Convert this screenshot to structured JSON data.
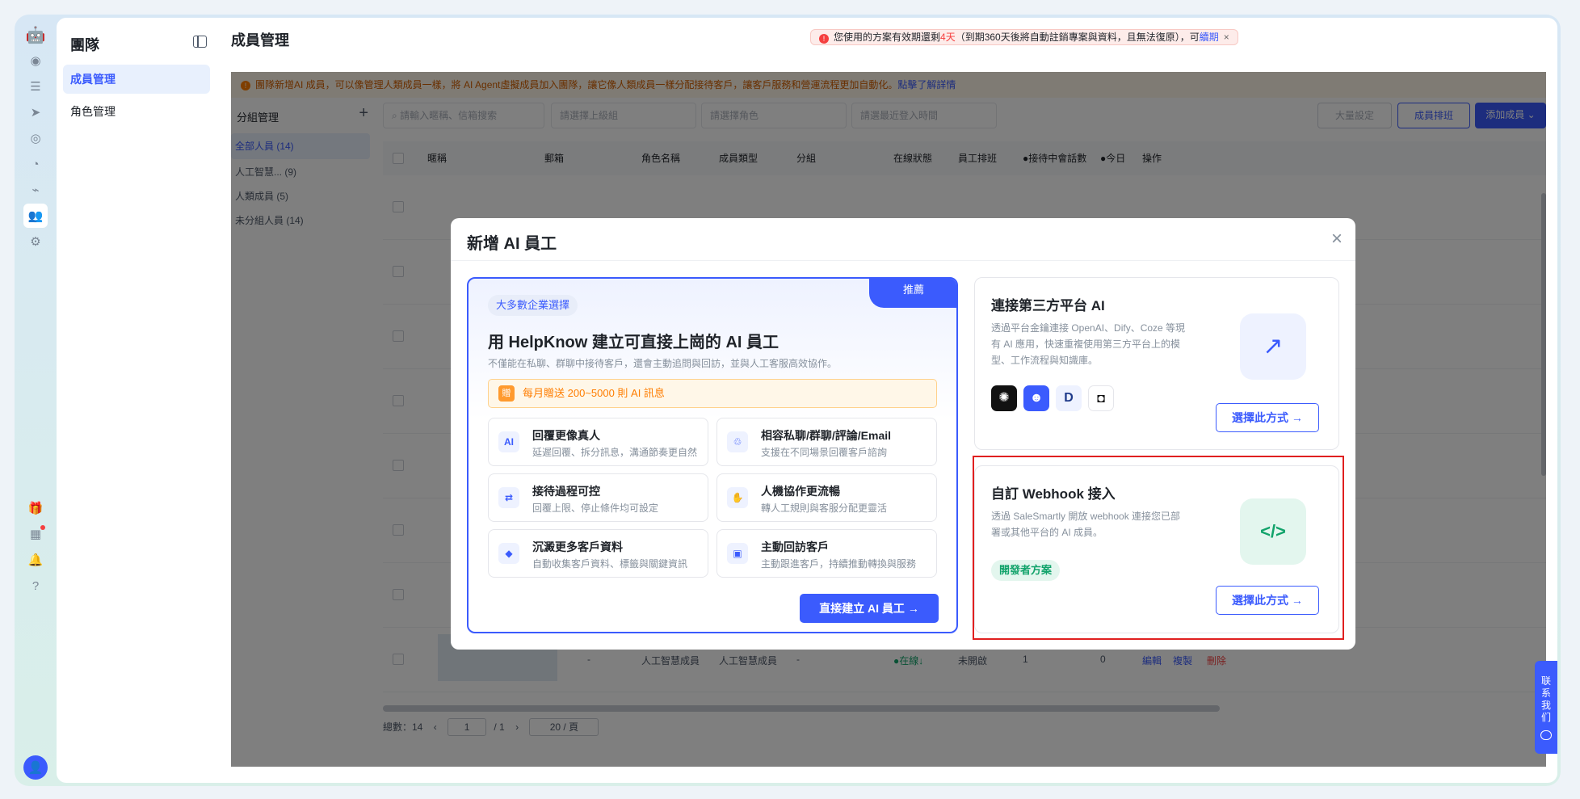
{
  "banner": {
    "pre": "您使用的方案有效期還剩",
    "days": "4天",
    "post": "（到期360天後將自動註銷專案與資料，且無法復原），可",
    "link": "續期",
    "close": "×"
  },
  "sidebar": {
    "title": "團隊",
    "items": [
      "成員管理",
      "角色管理"
    ]
  },
  "page": {
    "title": "成員管理"
  },
  "notice": {
    "text": "團隊新增AI 成員，可以像管理人類成員一樣，將 AI Agent虛擬成員加入團隊，讓它像人類成員一樣分配接待客戶，讓客戶服務和營運流程更加自動化。",
    "link": "點擊了解詳情"
  },
  "groups": {
    "title": "分組管理",
    "add": "+",
    "items": [
      "全部人員 (14)",
      "人工智慧...   (9)",
      "人類成員 (5)",
      "未分組人員 (14)"
    ]
  },
  "filters": {
    "search": "請輸入暱稱、信箱搜索",
    "supervisor": "請選擇上級組",
    "role": "請選擇角色",
    "last_login": "請選最近登入時間"
  },
  "toolbar": {
    "bulk": "大量設定",
    "schedule": "成員排班",
    "add": "添加成員 ⌄"
  },
  "table": {
    "headers": [
      "暱稱",
      "郵箱",
      "角色名稱",
      "成員類型",
      "分組",
      "在線狀態",
      "員工排班",
      "●接待中會話數",
      "●今日",
      "操作"
    ],
    "last_row": {
      "mail": "-",
      "role": "人工智慧成員",
      "type": "人工智慧成員",
      "group": "-",
      "status": "●在線↓",
      "schedule": "未開啟",
      "count": "1",
      "today": "0"
    },
    "ops": {
      "edit": "編輯",
      "copy": "複製",
      "delete": "刪除"
    }
  },
  "pager": {
    "total": "總數：14",
    "page": "1",
    "of": "/ 1",
    "size": "20 / 頁"
  },
  "contact": {
    "label": "联系我们"
  },
  "modal": {
    "title": "新增 AI 員工",
    "close": "×",
    "left": {
      "ribbon": "推薦",
      "tag": "大多數企業選擇",
      "heading": "用 HelpKnow 建立可直接上崗的 AI 員工",
      "desc": "不僅能在私聊、群聊中接待客戶，還會主動追問與回訪，並與人工客服高效協作。",
      "promo": "每月贈送 200~5000 則 AI 訊息",
      "features": [
        {
          "title": "回覆更像真人",
          "desc": "延遲回覆、拆分訊息，溝通節奏更自然",
          "icon": "AI"
        },
        {
          "title": "相容私聊/群聊/評論/Email",
          "desc": "支援在不同場景回覆客戶諮詢",
          "icon": "♲"
        },
        {
          "title": "接待過程可控",
          "desc": "回覆上限、停止條件均可設定",
          "icon": "⇄"
        },
        {
          "title": "人機協作更流暢",
          "desc": "轉人工規則與客服分配更靈活",
          "icon": "✋"
        },
        {
          "title": "沉澱更多客戶資料",
          "desc": "自動收集客戶資料、標籤與關鍵資訊",
          "icon": "◆"
        },
        {
          "title": "主動回訪客戶",
          "desc": "主動跟進客戶，持續推動轉換與服務",
          "icon": "▣"
        }
      ],
      "cta": "直接建立 AI 員工 →"
    },
    "third_party": {
      "title": "連接第三方平台 AI",
      "desc": "透過平台金鑰連接 OpenAI、Dify、Coze 等現有 AI 應用，快速重複使用第三方平台上的模型、工作流程與知識庫。",
      "icon": "↗",
      "choose": "選擇此方式 →"
    },
    "webhook": {
      "title": "自訂 Webhook 接入",
      "desc": "透過 SaleSmartly 開放 webhook 連接您已部署或其他平台的 AI 成員。",
      "tag": "開發者方案",
      "icon": "</>",
      "choose": "選擇此方式 →"
    }
  },
  "colors": {
    "primary": "#3b5bfd",
    "danger": "#f53f3f",
    "warning": "#ff7d00",
    "success": "#12a36b"
  }
}
